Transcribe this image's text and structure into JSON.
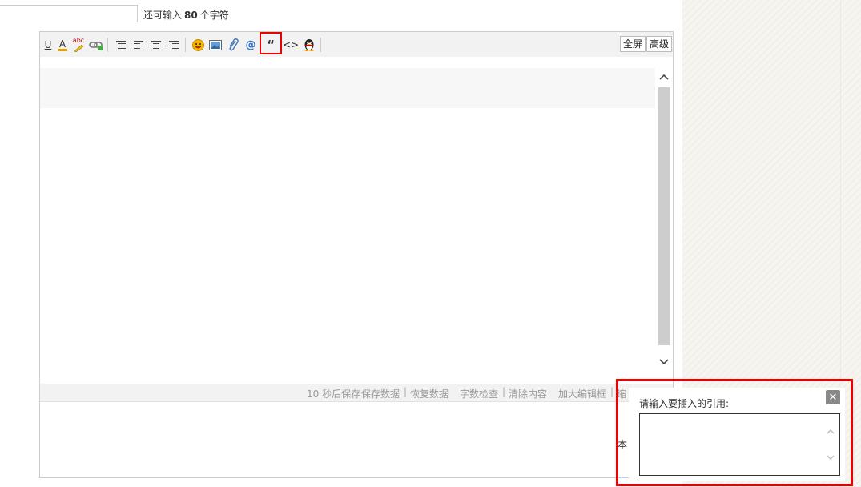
{
  "title_field": {
    "value": ""
  },
  "char_limit": {
    "prefix": "还可输入",
    "count": "80",
    "suffix": "个字符"
  },
  "toolbar": {
    "icons": {
      "underline": "U",
      "font_color": "A",
      "spellcheck": "abc",
      "quote": "“",
      "code": "<>"
    },
    "fullscreen_label": "全屏",
    "advanced_label": "高级"
  },
  "status_bar": {
    "autosave": "10 秒后保存",
    "save": "保存数据",
    "restore": "恢复数据",
    "word_check": "字数检查",
    "clear": "清除内容",
    "enlarge": "加大编辑框",
    "shrink": "缩"
  },
  "side_text": "本",
  "quote_popup": {
    "label": "请输入要插入的引用:",
    "close_label": "✕",
    "textarea_value": ""
  },
  "colors": {
    "highlight": "#e00000"
  }
}
